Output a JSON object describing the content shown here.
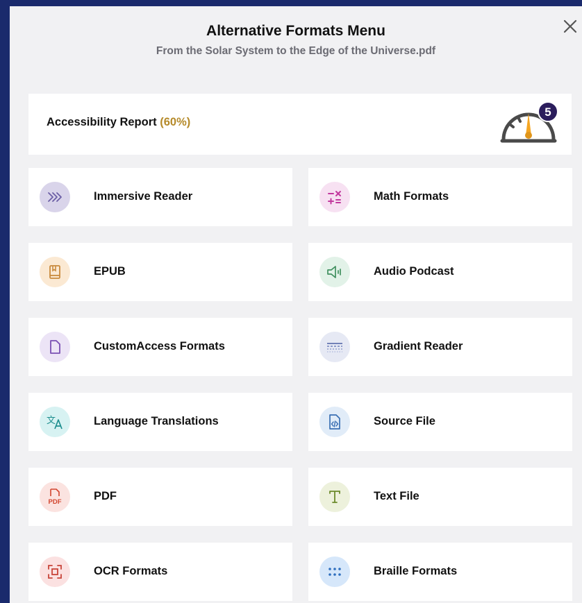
{
  "modal": {
    "title": "Alternative Formats Menu",
    "subtitle": "From the Solar System to the Edge of the Universe.pdf",
    "close_icon": "close-icon"
  },
  "report": {
    "label": "Accessibility Report",
    "percent_text": "(60%)",
    "badge_count": "5",
    "gauge_level_percent": 60,
    "accent_color": "#b58a2a",
    "badge_color": "#2b1d5c"
  },
  "formats": [
    {
      "label": "Immersive Reader",
      "icon": "chevrons-right-icon",
      "bg": "#d9d4ea"
    },
    {
      "label": "Math Formats",
      "icon": "math-operators-icon",
      "bg": "#f7e1f2"
    },
    {
      "label": "EPUB",
      "icon": "book-icon",
      "bg": "#fbe9d3"
    },
    {
      "label": "Audio Podcast",
      "icon": "speaker-icon",
      "bg": "#e2f2e8"
    },
    {
      "label": "CustomAccess Formats",
      "icon": "document-icon",
      "bg": "#ece4f6"
    },
    {
      "label": "Gradient Reader",
      "icon": "gradient-lines-icon",
      "bg": "#e6e9f4"
    },
    {
      "label": "Language Translations",
      "icon": "translate-icon",
      "bg": "#d7f2f2"
    },
    {
      "label": "Source File",
      "icon": "code-file-icon",
      "bg": "#e1ecf8"
    },
    {
      "label": "PDF",
      "icon": "pdf-icon",
      "bg": "#fbe3e0"
    },
    {
      "label": "Text File",
      "icon": "text-t-icon",
      "bg": "#edf1dc"
    },
    {
      "label": "OCR Formats",
      "icon": "scan-icon",
      "bg": "#fbe1e1"
    },
    {
      "label": "Braille Formats",
      "icon": "braille-dots-icon",
      "bg": "#d6e7fa"
    }
  ]
}
